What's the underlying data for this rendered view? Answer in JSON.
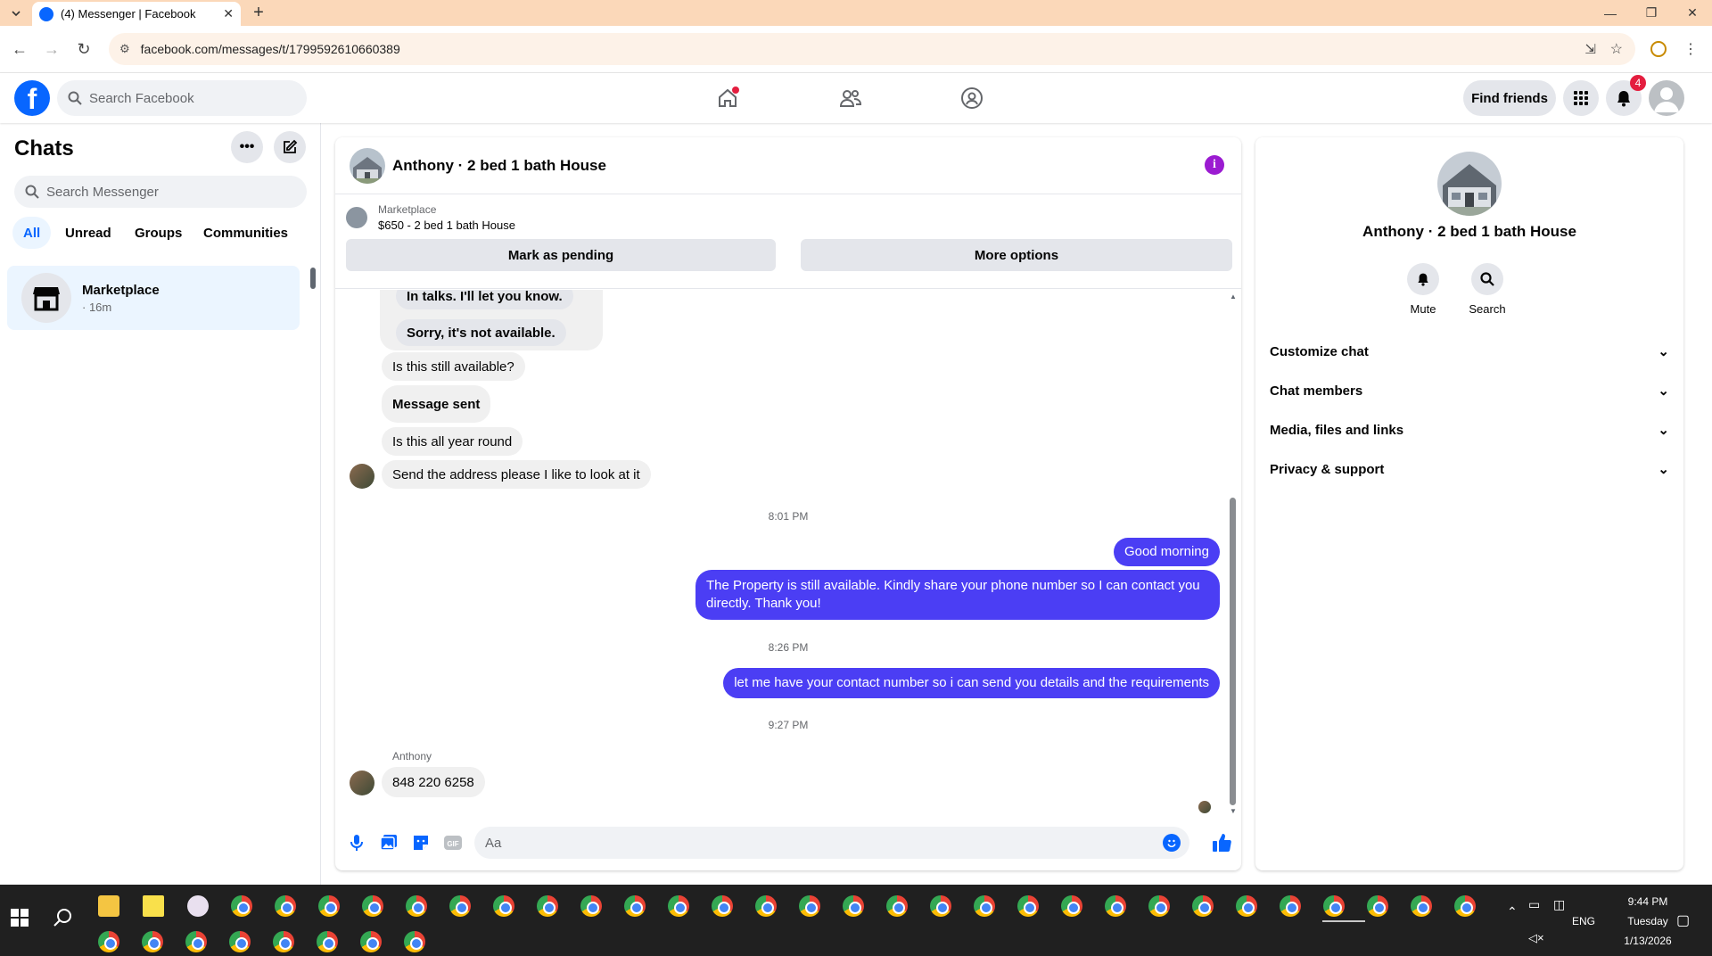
{
  "browser": {
    "tab_title": "(4) Messenger | Facebook",
    "url": "facebook.com/messages/t/1799592610660389",
    "new_tab": "+"
  },
  "fb_header": {
    "logo": "f",
    "search_placeholder": "Search Facebook",
    "find_friends": "Find friends",
    "notification_count": "4"
  },
  "sidebar": {
    "title": "Chats",
    "search_placeholder": "Search Messenger",
    "filters": [
      "All",
      "Unread",
      "Groups",
      "Communities"
    ],
    "active_filter": "All",
    "chats": [
      {
        "name": "Marketplace",
        "subtitle": "· 16m"
      }
    ]
  },
  "conversation": {
    "title": "Anthony · 2 bed 1 bath House",
    "marketplace_label": "Marketplace",
    "listing": "$650 - 2 bed 1 bath House",
    "mark_pending": "Mark as pending",
    "more_options": "More options",
    "messages": [
      {
        "from": "them",
        "text": "In talks. I'll let you know."
      },
      {
        "from": "them",
        "text": "Sorry, it's not available."
      },
      {
        "from": "them",
        "text": "Is this still available?"
      },
      {
        "from": "them",
        "text": "Message sent"
      },
      {
        "from": "them",
        "text": "Is this all year round"
      },
      {
        "from": "them",
        "text": "Send the address please I like to look at it"
      },
      {
        "type": "timestamp",
        "text": "8:01 PM"
      },
      {
        "from": "me",
        "text": "Good morning"
      },
      {
        "from": "me",
        "text": "The Property is still available. Kindly share your phone number so I can contact you directly. Thank you!"
      },
      {
        "type": "timestamp",
        "text": "8:26 PM"
      },
      {
        "from": "me",
        "text": "let me have your contact number so i can send you details and the requirements"
      },
      {
        "type": "timestamp",
        "text": "9:27 PM"
      },
      {
        "from": "them",
        "sender": "Anthony",
        "text": "848 220 6258"
      }
    ],
    "input_placeholder": "Aa"
  },
  "details_panel": {
    "name": "Anthony · 2 bed 1 bath House",
    "actions": [
      "Mute",
      "Search"
    ],
    "sections": [
      "Customize chat",
      "Chat members",
      "Media, files and links",
      "Privacy & support"
    ]
  },
  "taskbar": {
    "time": "9:44 PM",
    "day": "Tuesday",
    "date": "1/13/2026",
    "language": "ENG"
  },
  "colors": {
    "accent": "#0866ff",
    "my_bubble": "#4b3ef4",
    "info_icon": "#9b1bd1",
    "tab_strip": "#fbd8b9"
  }
}
